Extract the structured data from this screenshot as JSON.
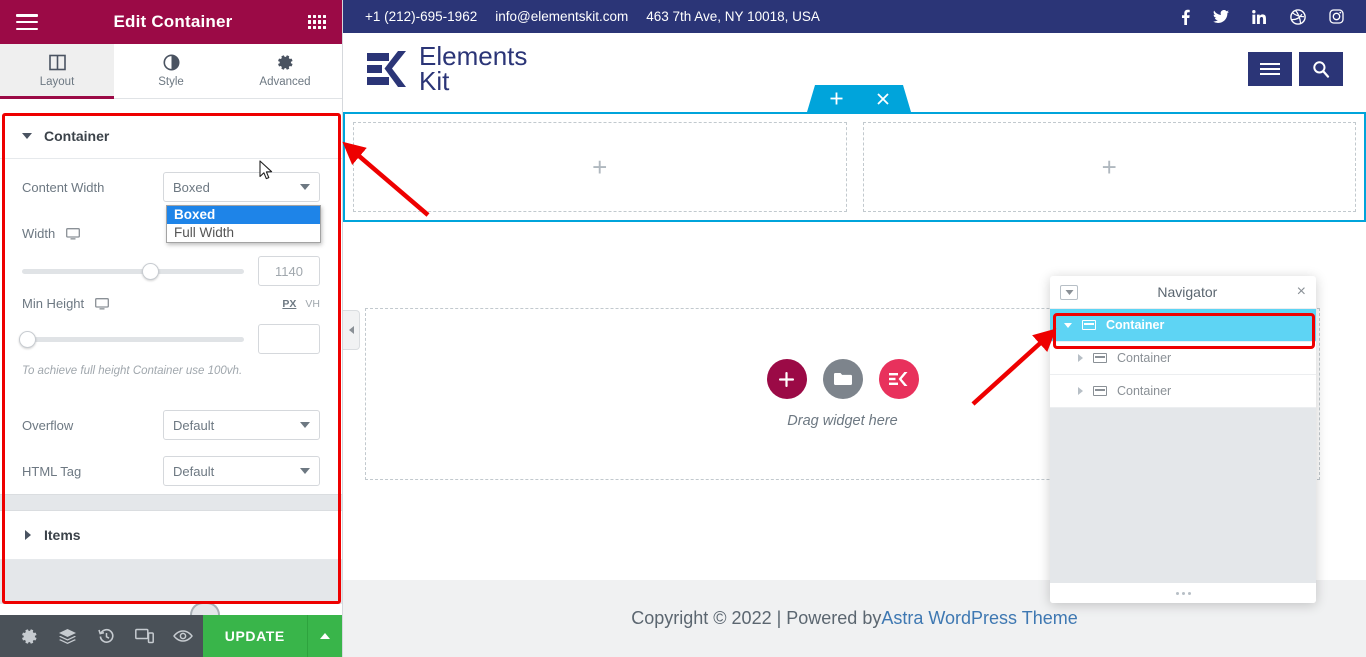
{
  "panel": {
    "header": {
      "title": "Edit Container",
      "menu_icon": "hamburger-icon",
      "apps_icon": "grid-apps-icon"
    },
    "tabs": [
      {
        "label": "Layout",
        "icon": "columns-icon",
        "active": true
      },
      {
        "label": "Style",
        "icon": "contrast-circle-icon",
        "active": false
      },
      {
        "label": "Advanced",
        "icon": "gear-icon",
        "active": false
      }
    ],
    "sections": {
      "container": {
        "label": "Container",
        "expanded": true
      },
      "items": {
        "label": "Items",
        "expanded": false
      }
    },
    "controls": {
      "content_width": {
        "label": "Content Width",
        "value": "Boxed",
        "options": [
          "Boxed",
          "Full Width"
        ],
        "selected_option": "Boxed",
        "open": true
      },
      "width": {
        "label": "Width",
        "value": "1140",
        "device_icon": "desktop-icon",
        "slider_percent": 56
      },
      "min_height": {
        "label": "Min Height",
        "value": "",
        "device_icon": "desktop-icon",
        "slider_percent": 0,
        "units": [
          "PX",
          "VH"
        ],
        "active_unit": "PX"
      },
      "hint": "To achieve full height Container use 100vh.",
      "overflow": {
        "label": "Overflow",
        "value": "Default"
      },
      "html_tag": {
        "label": "HTML Tag",
        "value": "Default"
      }
    },
    "footer": {
      "icons": [
        "settings-gear-icon",
        "layers-icon",
        "history-revisions-icon",
        "responsive-preview-icon",
        "preview-eye-icon"
      ],
      "update_label": "UPDATE",
      "update_caret_icon": "caret-up-icon"
    },
    "collapse_icon": "chevron-left-icon"
  },
  "preview": {
    "topbar": {
      "phone": "+1 (212)-695-1962",
      "email": "info@elementskit.com",
      "address": "463 7th Ave, NY 10018, USA",
      "social": [
        "facebook-icon",
        "twitter-icon",
        "linkedin-icon",
        "dribbble-icon",
        "instagram-icon"
      ],
      "bg_color": "#2b3577"
    },
    "site_header": {
      "logo_line1": "Elements",
      "logo_line2": "Kit",
      "logo_icon": "elementskit-logo-icon",
      "buttons": [
        "menu-hamburger-icon",
        "search-icon"
      ],
      "button_color": "#2b3577"
    },
    "section_tools": {
      "add_icon": "plus-icon",
      "drag_icon": "drag-handle-icon",
      "delete_icon": "close-x-icon",
      "color": "#00a4db"
    },
    "selected_container": {
      "columns": [
        {
          "add_icon": "plus-icon"
        },
        {
          "add_icon": "plus-icon"
        }
      ],
      "outline_color": "#00a4db"
    },
    "drop_area": {
      "label": "Drag widget here",
      "icons": [
        {
          "name": "add-widget-icon",
          "glyph": "+",
          "color": "#9b0a46"
        },
        {
          "name": "template-folder-icon",
          "glyph": "folder",
          "color": "#7d848c"
        },
        {
          "name": "elementskit-widget-icon",
          "glyph": "EK",
          "color": "#e8315c"
        }
      ]
    },
    "site_footer": {
      "text": "Copyright © 2022 | Powered by ",
      "link": "Astra WordPress Theme"
    }
  },
  "navigator": {
    "title": "Navigator",
    "dock_icon": "dock-toggle-icon",
    "close_icon": "close-icon",
    "items": [
      {
        "label": "Container",
        "level": 0,
        "selected": true,
        "expanded": true,
        "icon": "container-icon"
      },
      {
        "label": "Container",
        "level": 1,
        "selected": false,
        "expanded": false,
        "icon": "container-icon"
      },
      {
        "label": "Container",
        "level": 1,
        "selected": false,
        "expanded": false,
        "icon": "container-icon"
      }
    ],
    "resize_icon": "resize-dots-icon",
    "selected_color": "#5ed4f4"
  },
  "annotations": {
    "highlight_color": "#ee0000",
    "arrows": [
      {
        "name": "arrow-to-container-outline"
      },
      {
        "name": "arrow-to-navigator-container"
      }
    ]
  }
}
